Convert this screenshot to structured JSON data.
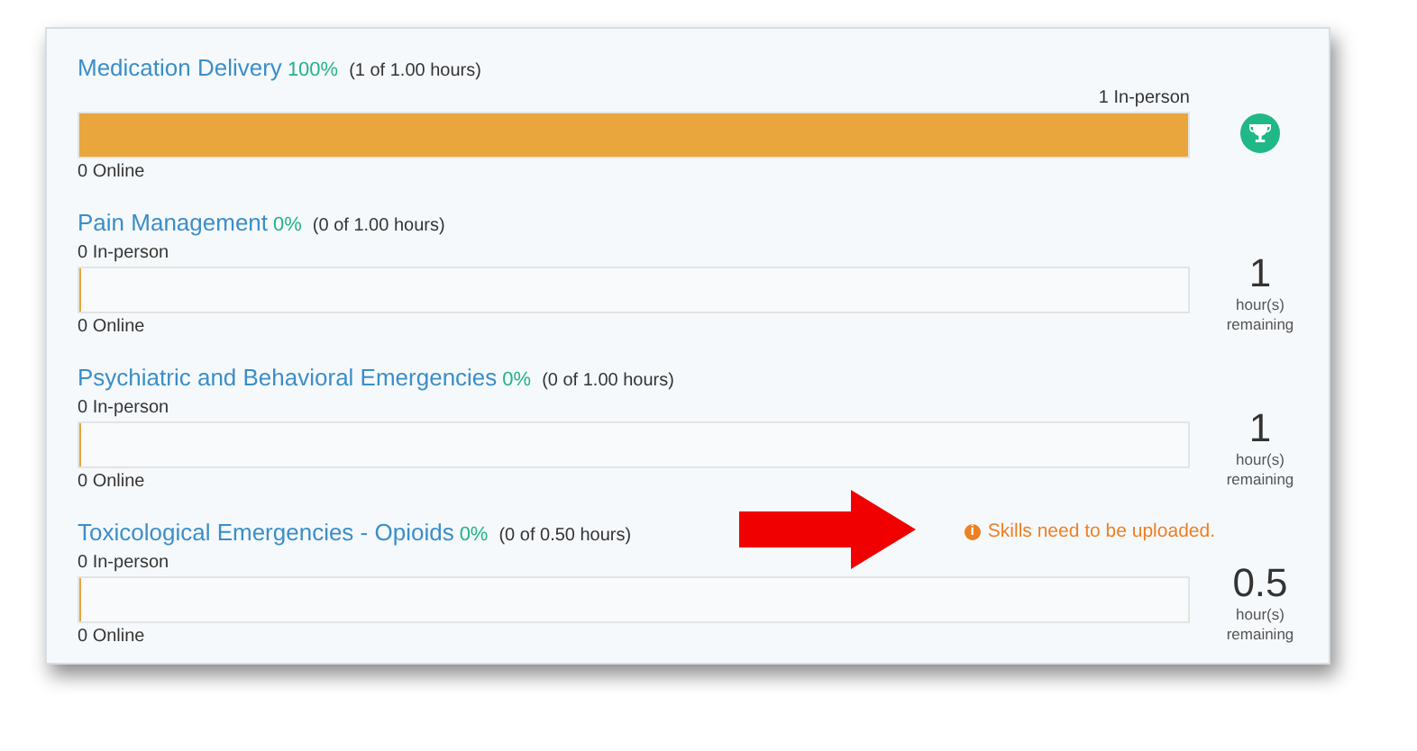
{
  "courses": [
    {
      "title": "Medication Delivery",
      "percent": "100%",
      "hours": "(1 of 1.00 hours)",
      "in_person": "1 In-person",
      "online": "0 Online",
      "level": 1,
      "status": {
        "kind": "trophy"
      }
    },
    {
      "title": "Pain Management",
      "percent": "0%",
      "hours": "(0 of 1.00 hours)",
      "in_person": "0 In-person",
      "online": "0 Online",
      "level": 0,
      "status": {
        "kind": "remaining",
        "value": "1",
        "unit": "hour(s)",
        "label": "remaining"
      }
    },
    {
      "title": "Psychiatric and Behavioral Emergencies",
      "percent": "0%",
      "hours": "(0 of 1.00 hours)",
      "in_person": "0 In-person",
      "online": "0 Online",
      "level": 0,
      "status": {
        "kind": "remaining",
        "value": "1",
        "unit": "hour(s)",
        "label": "remaining"
      }
    },
    {
      "title": "Toxicological Emergencies - Opioids",
      "percent": "0%",
      "hours": "(0 of 0.50 hours)",
      "in_person": "0 In-person",
      "online": "0 Online",
      "level": 0,
      "warning": {
        "icon": "i",
        "text": "Skills need to be uploaded.",
        "arrow": true
      },
      "status": {
        "kind": "remaining",
        "value": "0.5",
        "unit": "hour(s)",
        "label": "remaining"
      }
    }
  ]
}
